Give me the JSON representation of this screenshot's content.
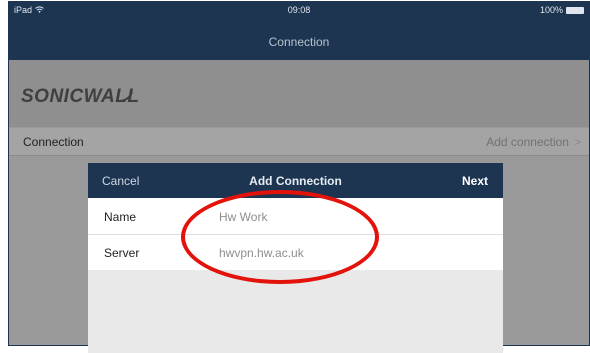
{
  "status_bar": {
    "device": "iPad",
    "time": "09:08",
    "battery": "100%"
  },
  "nav": {
    "title": "Connection"
  },
  "logo": {
    "text": "SONICWALL"
  },
  "connection_row": {
    "label": "Connection",
    "action": "Add connection",
    "chevron": ">"
  },
  "modal": {
    "cancel": "Cancel",
    "title": "Add Connection",
    "next": "Next",
    "fields": [
      {
        "label": "Name",
        "value": "Hw Work"
      },
      {
        "label": "Server",
        "value": "hwvpn.hw.ac.uk"
      }
    ]
  },
  "colors": {
    "nav_bar": "#1d3550",
    "annotation": "#e3120b"
  },
  "icons": {
    "wifi": "wifi-icon",
    "battery": "battery-icon",
    "chevron": "chevron-right-icon"
  }
}
